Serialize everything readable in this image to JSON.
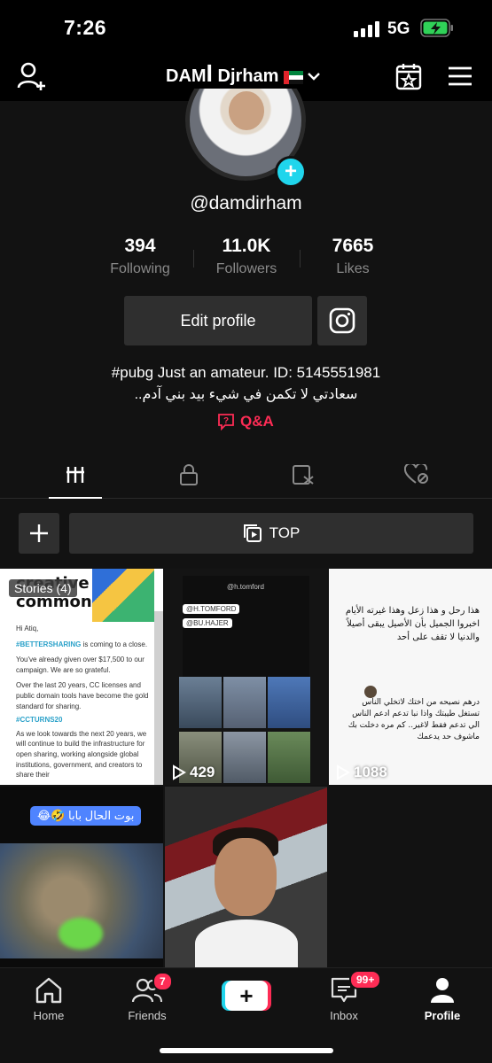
{
  "status_bar": {
    "time": "7:26",
    "network": "5G"
  },
  "nav": {
    "title": "DAMꟾ Djrham"
  },
  "profile": {
    "handle": "@damdirham",
    "stats": [
      {
        "value": "394",
        "label": "Following"
      },
      {
        "value": "11.0K",
        "label": "Followers"
      },
      {
        "value": "7665",
        "label": "Likes"
      }
    ],
    "edit_label": "Edit profile",
    "bio_line1": "#pubg Just an amateur. ID: 5145551981",
    "bio_line2": "سعادتي لا تكمن في شيء بيد بني آدم..",
    "qa_label": "Q&A"
  },
  "toolbar": {
    "top_label": "TOP"
  },
  "videos": [
    {
      "overlay": "Stories (4)",
      "cc_logo": "creative commons",
      "cc_greeting": "Hi Atiq,",
      "cc_tag": "#BETTERSHARING",
      "cc_body1": "is coming to a close.",
      "cc_body2": "You've already given over $17,500 to our campaign. We are so grateful.",
      "cc_body3": "Over the last 20 years, CC licenses and public domain tools have become the gold standard for sharing.",
      "cc_hashtag": "#CCTURNS20",
      "cc_body4": "As we look towards the next 20 years, we will continue to build the infrastructure for open sharing, working alongside global institutions, government, and creators to share their"
    },
    {
      "views": "429",
      "tag1": "@H.TOMFORD",
      "tag2": "@BU.HAJER",
      "handle": "@h.tomford"
    },
    {
      "views": "1088",
      "text1": "هذا رحل و هذا زعل وهذا غيرته الأيام اخبروا الجميل بأن الأصيل يبقى أصيلاً والدنيا لا تقف على أحد",
      "text2": "درهم نصيحه من اختك لاتخلي الناس تستغل طيبتك واذا نبا تدعم ادعم الناس الي تدعم فقط لاغير.. كم مره دخلت بك ماشوف حد يدعمك"
    },
    {
      "bubble": "بوت الحال بابا 🤣😂"
    },
    {}
  ],
  "bottom_nav": {
    "items": [
      {
        "label": "Home"
      },
      {
        "label": "Friends",
        "badge": "7"
      },
      {
        "label": "Inbox",
        "badge": "99+"
      },
      {
        "label": "Profile"
      }
    ]
  },
  "colors": {
    "accent_red": "#fe2c55",
    "accent_cyan": "#20d5ec",
    "background": "#121212"
  }
}
